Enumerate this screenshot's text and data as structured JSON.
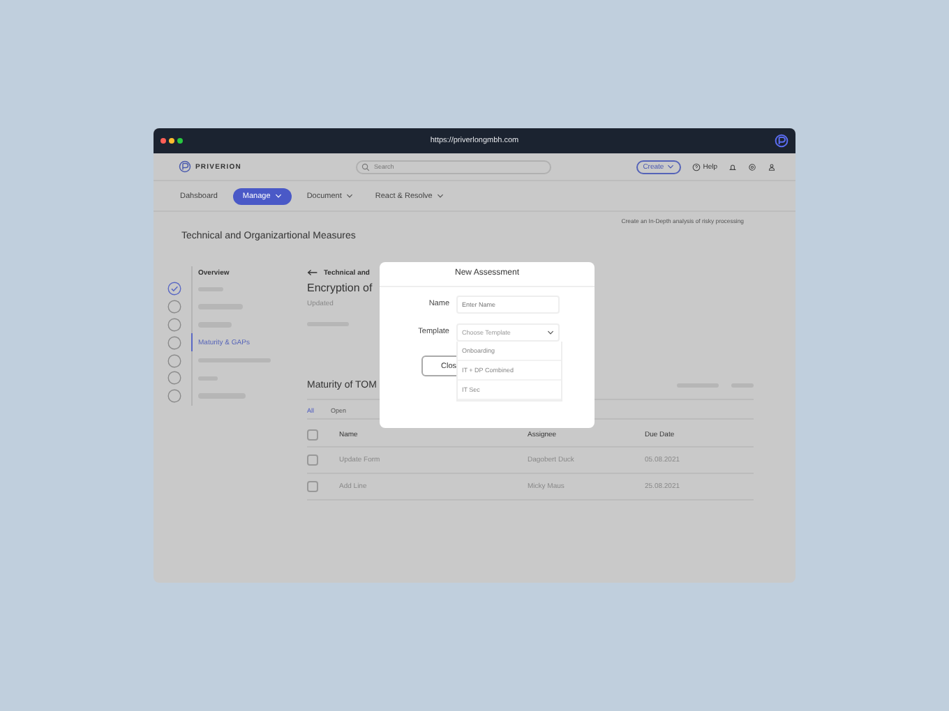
{
  "browser": {
    "url": "https://priverlongmbh.com"
  },
  "header": {
    "brand": "PRIVERION",
    "search_placeholder": "Search",
    "create_label": "Create",
    "help_label": "Help"
  },
  "nav": [
    {
      "label": "Dahsboard",
      "selected": false,
      "menu": false
    },
    {
      "label": "Manage",
      "selected": true,
      "menu": true
    },
    {
      "label": "Document",
      "selected": false,
      "menu": true
    },
    {
      "label": "React & Resolve",
      "selected": false,
      "menu": true
    }
  ],
  "hint": "Create an In-Depth analysis of risky processing",
  "page_title": "Technical and Organizartional Measures",
  "stepper": {
    "heading": "Overview",
    "steps": [
      {
        "checked": true,
        "selected": false
      },
      {
        "checked": false,
        "selected": false
      },
      {
        "checked": false,
        "selected": false
      },
      {
        "label": "Maturity & GAPs",
        "checked": false,
        "selected": true
      },
      {
        "checked": false,
        "selected": false
      },
      {
        "checked": false,
        "selected": false
      },
      {
        "checked": false,
        "selected": false
      }
    ]
  },
  "detail": {
    "back_label": "Technical and",
    "title": "Encryption of",
    "updated_label": "Updated"
  },
  "section": {
    "title": "Maturity of TOM",
    "tabs": [
      {
        "label": "All",
        "selected": true
      },
      {
        "label": "Open",
        "selected": false
      }
    ],
    "columns": [
      "Name",
      "Assignee",
      "Due Date"
    ],
    "select_all_checked": false,
    "rows": [
      {
        "checked": false,
        "cells": [
          "Update Form",
          "Dagobert Duck",
          "05.08.2021"
        ]
      },
      {
        "checked": false,
        "cells": [
          "Add Line",
          "Micky Maus",
          "25.08.2021"
        ]
      }
    ]
  },
  "modal": {
    "title": "New Assessment",
    "name_label": "Name",
    "name_placeholder": "Enter Name",
    "template_label": "Template",
    "template_placeholder": "Choose Template",
    "options": [
      "Onboarding",
      "IT + DP Combined",
      "IT Sec"
    ],
    "close_label": "Clos"
  }
}
